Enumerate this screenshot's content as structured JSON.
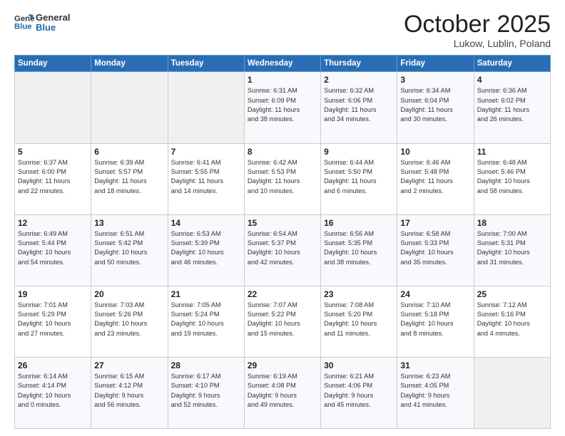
{
  "header": {
    "logo_line1": "General",
    "logo_line2": "Blue",
    "month": "October 2025",
    "location": "Lukow, Lublin, Poland"
  },
  "weekdays": [
    "Sunday",
    "Monday",
    "Tuesday",
    "Wednesday",
    "Thursday",
    "Friday",
    "Saturday"
  ],
  "weeks": [
    [
      {
        "day": "",
        "info": ""
      },
      {
        "day": "",
        "info": ""
      },
      {
        "day": "",
        "info": ""
      },
      {
        "day": "1",
        "info": "Sunrise: 6:31 AM\nSunset: 6:09 PM\nDaylight: 11 hours\nand 38 minutes."
      },
      {
        "day": "2",
        "info": "Sunrise: 6:32 AM\nSunset: 6:06 PM\nDaylight: 11 hours\nand 34 minutes."
      },
      {
        "day": "3",
        "info": "Sunrise: 6:34 AM\nSunset: 6:04 PM\nDaylight: 11 hours\nand 30 minutes."
      },
      {
        "day": "4",
        "info": "Sunrise: 6:36 AM\nSunset: 6:02 PM\nDaylight: 11 hours\nand 26 minutes."
      }
    ],
    [
      {
        "day": "5",
        "info": "Sunrise: 6:37 AM\nSunset: 6:00 PM\nDaylight: 11 hours\nand 22 minutes."
      },
      {
        "day": "6",
        "info": "Sunrise: 6:39 AM\nSunset: 5:57 PM\nDaylight: 11 hours\nand 18 minutes."
      },
      {
        "day": "7",
        "info": "Sunrise: 6:41 AM\nSunset: 5:55 PM\nDaylight: 11 hours\nand 14 minutes."
      },
      {
        "day": "8",
        "info": "Sunrise: 6:42 AM\nSunset: 5:53 PM\nDaylight: 11 hours\nand 10 minutes."
      },
      {
        "day": "9",
        "info": "Sunrise: 6:44 AM\nSunset: 5:50 PM\nDaylight: 11 hours\nand 6 minutes."
      },
      {
        "day": "10",
        "info": "Sunrise: 6:46 AM\nSunset: 5:48 PM\nDaylight: 11 hours\nand 2 minutes."
      },
      {
        "day": "11",
        "info": "Sunrise: 6:48 AM\nSunset: 5:46 PM\nDaylight: 10 hours\nand 58 minutes."
      }
    ],
    [
      {
        "day": "12",
        "info": "Sunrise: 6:49 AM\nSunset: 5:44 PM\nDaylight: 10 hours\nand 54 minutes."
      },
      {
        "day": "13",
        "info": "Sunrise: 6:51 AM\nSunset: 5:42 PM\nDaylight: 10 hours\nand 50 minutes."
      },
      {
        "day": "14",
        "info": "Sunrise: 6:53 AM\nSunset: 5:39 PM\nDaylight: 10 hours\nand 46 minutes."
      },
      {
        "day": "15",
        "info": "Sunrise: 6:54 AM\nSunset: 5:37 PM\nDaylight: 10 hours\nand 42 minutes."
      },
      {
        "day": "16",
        "info": "Sunrise: 6:56 AM\nSunset: 5:35 PM\nDaylight: 10 hours\nand 38 minutes."
      },
      {
        "day": "17",
        "info": "Sunrise: 6:58 AM\nSunset: 5:33 PM\nDaylight: 10 hours\nand 35 minutes."
      },
      {
        "day": "18",
        "info": "Sunrise: 7:00 AM\nSunset: 5:31 PM\nDaylight: 10 hours\nand 31 minutes."
      }
    ],
    [
      {
        "day": "19",
        "info": "Sunrise: 7:01 AM\nSunset: 5:29 PM\nDaylight: 10 hours\nand 27 minutes."
      },
      {
        "day": "20",
        "info": "Sunrise: 7:03 AM\nSunset: 5:26 PM\nDaylight: 10 hours\nand 23 minutes."
      },
      {
        "day": "21",
        "info": "Sunrise: 7:05 AM\nSunset: 5:24 PM\nDaylight: 10 hours\nand 19 minutes."
      },
      {
        "day": "22",
        "info": "Sunrise: 7:07 AM\nSunset: 5:22 PM\nDaylight: 10 hours\nand 15 minutes."
      },
      {
        "day": "23",
        "info": "Sunrise: 7:08 AM\nSunset: 5:20 PM\nDaylight: 10 hours\nand 11 minutes."
      },
      {
        "day": "24",
        "info": "Sunrise: 7:10 AM\nSunset: 5:18 PM\nDaylight: 10 hours\nand 8 minutes."
      },
      {
        "day": "25",
        "info": "Sunrise: 7:12 AM\nSunset: 5:16 PM\nDaylight: 10 hours\nand 4 minutes."
      }
    ],
    [
      {
        "day": "26",
        "info": "Sunrise: 6:14 AM\nSunset: 4:14 PM\nDaylight: 10 hours\nand 0 minutes."
      },
      {
        "day": "27",
        "info": "Sunrise: 6:15 AM\nSunset: 4:12 PM\nDaylight: 9 hours\nand 56 minutes."
      },
      {
        "day": "28",
        "info": "Sunrise: 6:17 AM\nSunset: 4:10 PM\nDaylight: 9 hours\nand 52 minutes."
      },
      {
        "day": "29",
        "info": "Sunrise: 6:19 AM\nSunset: 4:08 PM\nDaylight: 9 hours\nand 49 minutes."
      },
      {
        "day": "30",
        "info": "Sunrise: 6:21 AM\nSunset: 4:06 PM\nDaylight: 9 hours\nand 45 minutes."
      },
      {
        "day": "31",
        "info": "Sunrise: 6:23 AM\nSunset: 4:05 PM\nDaylight: 9 hours\nand 41 minutes."
      },
      {
        "day": "",
        "info": ""
      }
    ]
  ]
}
